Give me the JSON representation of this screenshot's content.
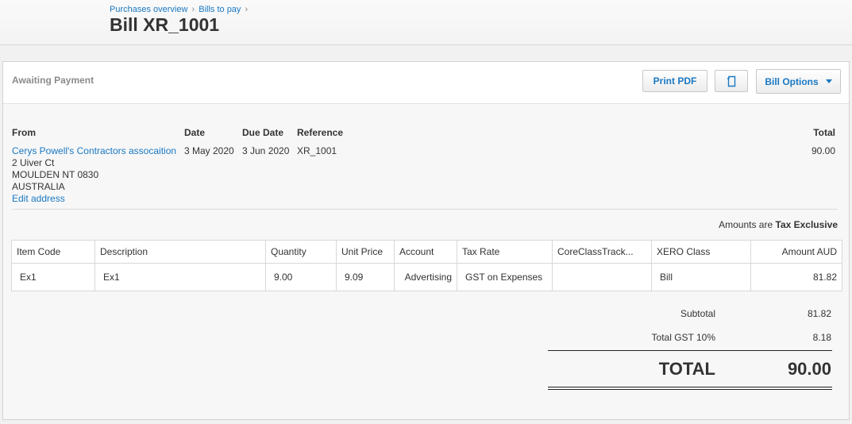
{
  "breadcrumb": {
    "items": [
      "Purchases overview",
      "Bills to pay"
    ],
    "separator": "›"
  },
  "title": "Bill XR_1001",
  "status": "Awaiting Payment",
  "buttons": {
    "print_pdf": "Print PDF",
    "copy_icon": "copy-icon",
    "bill_options": "Bill Options"
  },
  "bill": {
    "labels": {
      "from": "From",
      "date": "Date",
      "due_date": "Due Date",
      "reference": "Reference",
      "total": "Total"
    },
    "from": {
      "name": "Cerys Powell's Contractors assocaition",
      "address_lines": [
        "2 Uiver Ct",
        "MOULDEN NT 0830",
        "AUSTRALIA"
      ],
      "edit_address": "Edit address"
    },
    "date": "3 May 2020",
    "due_date": "3 Jun 2020",
    "reference": "XR_1001",
    "total": "90.00"
  },
  "amounts_are": {
    "prefix": "Amounts are",
    "value": "Tax Exclusive"
  },
  "table": {
    "headers": [
      "Item Code",
      "Description",
      "Quantity",
      "Unit Price",
      "Account",
      "Tax Rate",
      "CoreClassTrack...",
      "XERO Class",
      "Amount AUD"
    ],
    "rows": [
      [
        "Ex1",
        "Ex1",
        "9.00",
        "9.09",
        "Advertising",
        "GST on Expenses",
        "",
        "Bill",
        "81.82"
      ]
    ]
  },
  "summary": {
    "subtotal_label": "Subtotal",
    "subtotal": "81.82",
    "gst_label": "Total GST  10%",
    "gst": "8.18",
    "total_label": "TOTAL",
    "total": "90.00"
  },
  "colors": {
    "link": "#1a78c2",
    "text": "#333333",
    "status": "#8b8b8b"
  }
}
